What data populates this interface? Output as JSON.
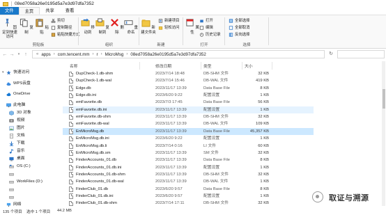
{
  "window": {
    "title": "08ed7058a26e0195d5a7e3d97dfa7352"
  },
  "ribbon": {
    "tabs": [
      "文件",
      "主页",
      "共享",
      "查看"
    ],
    "active_tab": "主页",
    "clipboard": {
      "pin": "固定到快速访问",
      "copy": "复制",
      "paste": "粘贴",
      "cut": "剪切",
      "copy_path": "复制路径",
      "paste_shortcut": "粘贴快捷方式",
      "label": "剪贴板"
    },
    "organize": {
      "move_to": "移动到",
      "copy_to": "复制到",
      "delete": "删除",
      "rename": "重命名",
      "label": "组织"
    },
    "new": {
      "new_folder": "新建文件夹",
      "new_item": "新建项目",
      "easy_access": "轻松访问",
      "label": "新建"
    },
    "open": {
      "properties": "属性",
      "open": "打开",
      "edit": "编辑",
      "history": "历史记录",
      "label": "打开"
    },
    "select": {
      "select_all": "全部选择",
      "select_none": "全部取消",
      "invert": "反向选择",
      "label": "选择"
    }
  },
  "address": {
    "breadcrumbs": [
      "apps",
      "com.tencent.mm",
      "r",
      "MicroMsg",
      "08ed7058a26e0195d5a7e3d97dfa7352"
    ]
  },
  "sidebar": {
    "items": [
      {
        "label": "快速访问",
        "icon": "star-icon"
      },
      {
        "label": "WPS云盘",
        "icon": "cloud-icon"
      },
      {
        "label": "OneDrive",
        "icon": "onedrive-icon"
      },
      {
        "label": "此电脑",
        "icon": "computer-icon"
      },
      {
        "label": "3D 对象",
        "icon": "cube-icon"
      },
      {
        "label": "视频",
        "icon": "video-icon"
      },
      {
        "label": "图片",
        "icon": "picture-icon"
      },
      {
        "label": "文档",
        "icon": "document-icon"
      },
      {
        "label": "下载",
        "icon": "download-icon"
      },
      {
        "label": "音乐",
        "icon": "music-icon"
      },
      {
        "label": "桌面",
        "icon": "desktop-icon"
      },
      {
        "label": "OS (C:)",
        "icon": "drive-icon"
      },
      {
        "label": "",
        "icon": "drive-icon"
      },
      {
        "label": "WorkFiles (D:)",
        "icon": "drive-icon"
      },
      {
        "label": "",
        "icon": "drive-icon"
      },
      {
        "label": "",
        "icon": "drive-icon"
      },
      {
        "label": "网络",
        "icon": "network-icon"
      }
    ]
  },
  "columns": {
    "name": "名称",
    "date": "修改日期",
    "type": "类型",
    "size": "大小"
  },
  "files": [
    {
      "name": "DupCheck-1.db-shm",
      "date": "2023/7/14 18:48",
      "type": "DB-SHM 文件",
      "size": "32 KB"
    },
    {
      "name": "DupCheck-1.db-wal",
      "date": "2023/7/14 15:46",
      "type": "DB-WAL 文件",
      "size": "419 KB"
    },
    {
      "name": "Edge.db",
      "date": "2023/11/17 13:39",
      "type": "Data Base File",
      "size": "8 KB"
    },
    {
      "name": "Edge.db.ini",
      "date": "2023/6/20 9:22",
      "type": "配置设置",
      "size": "1 KB"
    },
    {
      "name": "emFavorite.db",
      "date": "2023/7/3 17:45",
      "type": "Data Base File",
      "size": "56 KB"
    },
    {
      "name": "emFavorite.db.ini",
      "date": "2023/11/17 13:39",
      "type": "配置设置",
      "size": "1 KB"
    },
    {
      "name": "emFavorite.db-shm",
      "date": "2023/11/17 13:39",
      "type": "DB-SHM 文件",
      "size": "32 KB"
    },
    {
      "name": "emFavorite.db-wal",
      "date": "2023/11/17 13:39",
      "type": "DB-WAL 文件",
      "size": "109 KB"
    },
    {
      "name": "EnMicroMsg.db",
      "date": "2023/11/17 13:39",
      "type": "Data Base File",
      "size": "45,357 KB"
    },
    {
      "name": "EnMicroMsg.db.ini",
      "date": "2023/6/20 9:22",
      "type": "配置设置",
      "size": "1 KB"
    },
    {
      "name": "EnMicroMsg.db.li",
      "date": "2023/7/14 0:16",
      "type": "LI 文件",
      "size": "60 KB"
    },
    {
      "name": "EnMicroMsg.db.sm",
      "date": "2023/11/17 13:39",
      "type": "SM 文件",
      "size": "32 KB"
    },
    {
      "name": "FinderAccounts_01.db",
      "date": "2023/11/17 13:39",
      "type": "Data Base File",
      "size": "8 KB"
    },
    {
      "name": "FinderAccounts_01.db.ini",
      "date": "2023/11/17 13:39",
      "type": "配置设置",
      "size": "1 KB"
    },
    {
      "name": "FinderAccounts_01.db-shm",
      "date": "2023/11/17 13:39",
      "type": "DB-SHM 文件",
      "size": "32 KB"
    },
    {
      "name": "FinderAccounts_01.db-wal",
      "date": "2023/11/17 13:39",
      "type": "DB-WAL 文件",
      "size": "1 KB"
    },
    {
      "name": "FinderClub_01.db",
      "date": "2023/6/20 9:57",
      "type": "Data Base File",
      "size": "8 KB"
    },
    {
      "name": "FinderClub_01.db.ini",
      "date": "2023/6/20 9:57",
      "type": "配置设置",
      "size": "1 KB"
    },
    {
      "name": "FinderClub_01.db-shm",
      "date": "2023/7/14 17:11",
      "type": "DB-SHM 文件",
      "size": "32 KB"
    }
  ],
  "selected_file": "EnMicroMsg.db",
  "status": {
    "item_count": "135 个项目",
    "selected": "选中 1 个项目",
    "selected_size": "44.2 MB"
  },
  "watermark": {
    "text": "取证与溯源"
  },
  "colors": {
    "accent": "#1979ca",
    "selection": "#cce8ff",
    "hover": "#e5f3ff",
    "delete_red": "#e02020"
  }
}
